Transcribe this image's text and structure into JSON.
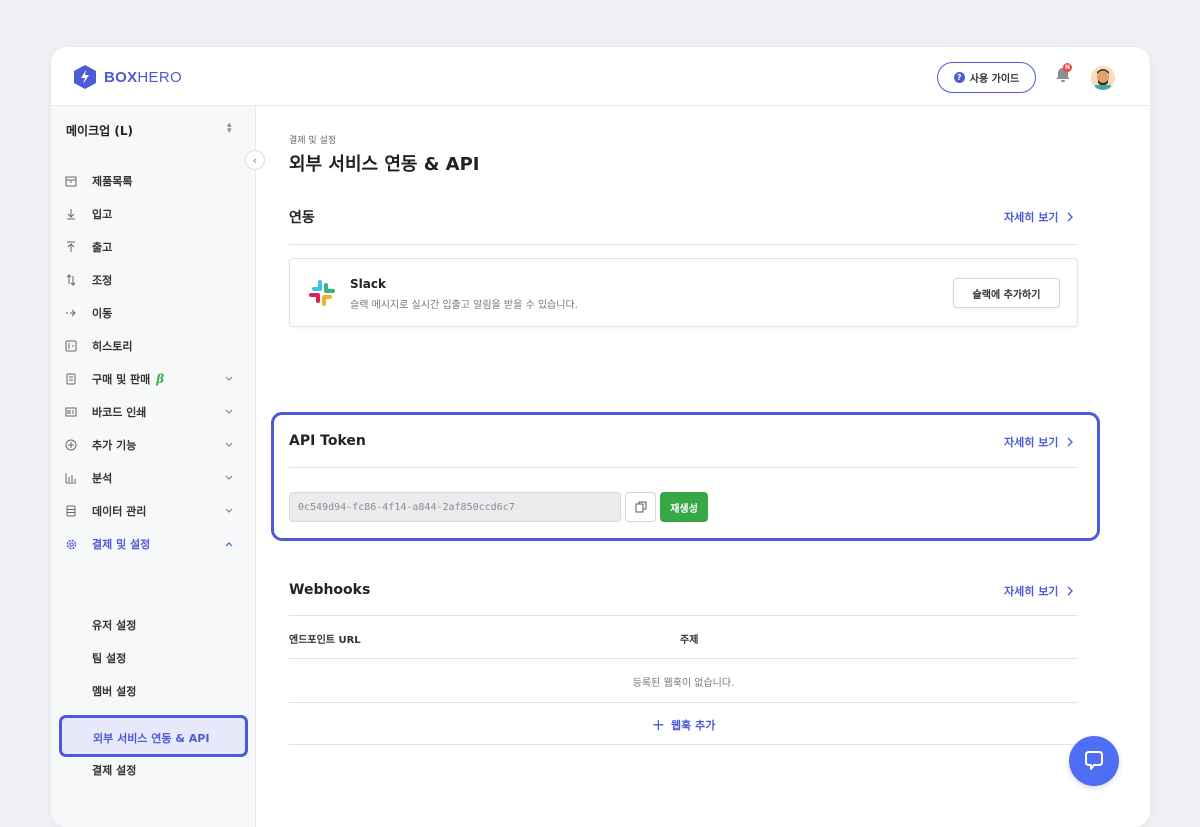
{
  "app": {
    "logo_bold": "BOX",
    "logo_light": "HERO",
    "guide_label": "사용 가이드",
    "notification_count": "N"
  },
  "sidebar": {
    "workspace": "메이크업 (L)",
    "items": [
      {
        "label": "제품목록",
        "icon": "box-icon"
      },
      {
        "label": "입고",
        "icon": "arrow-down-icon"
      },
      {
        "label": "출고",
        "icon": "arrow-up-icon"
      },
      {
        "label": "조정",
        "icon": "swap-vertical-icon"
      },
      {
        "label": "이동",
        "icon": "arrow-right-dotted-icon"
      },
      {
        "label": "히스토리",
        "icon": "history-icon"
      },
      {
        "label": "구매 및 판매",
        "icon": "document-icon",
        "badge": "β"
      },
      {
        "label": "바코드 인쇄",
        "icon": "barcode-icon"
      },
      {
        "label": "추가 기능",
        "icon": "plus-circle-icon"
      },
      {
        "label": "분석",
        "icon": "bar-chart-icon"
      },
      {
        "label": "데이터 관리",
        "icon": "database-icon"
      },
      {
        "label": "결제 및 설정",
        "icon": "gear-icon"
      }
    ],
    "sub_items": [
      "유저 설정",
      "팀 설정",
      "멤버 설정",
      "외부 서비스 연동 & API",
      "결제 설정"
    ],
    "active_sub": "외부 서비스 연동 & API"
  },
  "main": {
    "breadcrumb": "결제 및 설정",
    "title": "외부 서비스 연동 & API",
    "detail_link": "자세히 보기",
    "integration": {
      "title": "연동",
      "slack_name": "Slack",
      "slack_desc": "슬랙 메시지로 실시간 입출고 알림을 받을 수 있습니다.",
      "slack_button": "슬랙에 추가하기"
    },
    "api": {
      "title": "API Token",
      "token": "0c549d94-fc86-4f14-a844-2af850ccd6c7",
      "regenerate": "재생성"
    },
    "webhooks": {
      "title": "Webhooks",
      "col_endpoint": "엔드포인트 URL",
      "col_topic": "주제",
      "empty": "등록된 웹훅이 없습니다.",
      "add": "웹훅 추가"
    }
  },
  "colors": {
    "accent": "#4d5bd6",
    "success": "#36a844",
    "chat": "#4d6ef5"
  }
}
